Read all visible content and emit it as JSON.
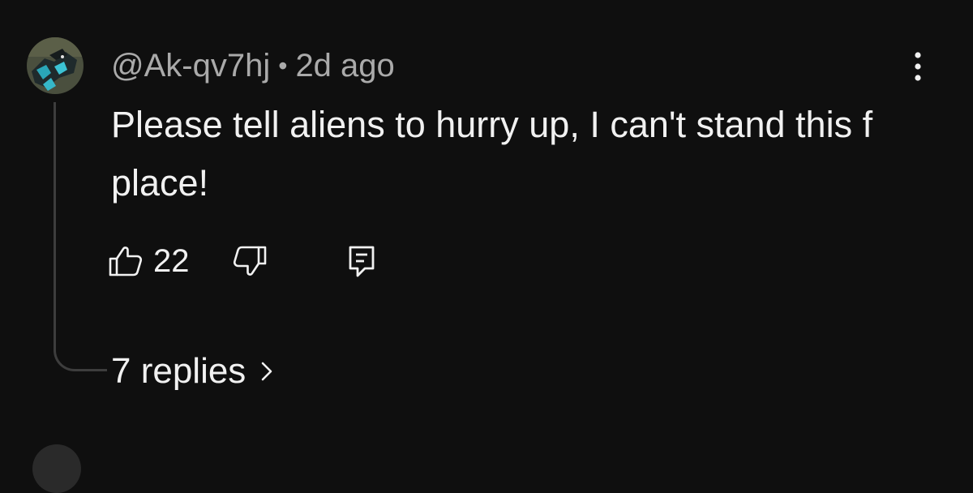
{
  "comment": {
    "author": "@Ak-qv7hj",
    "separator": "•",
    "time_ago": "2d ago",
    "text": "Please tell aliens to hurry up, I can't stand this f place!",
    "likes": "22",
    "icons": {
      "like": "thumbs-up-icon",
      "dislike": "thumbs-down-icon",
      "reply": "comment-reply-icon",
      "more": "more-vertical-icon",
      "chevron": "chevron-right-icon"
    },
    "replies_label": "7 replies"
  },
  "theme": {
    "background": "#0f0f0f",
    "text_primary": "#f1f1f1",
    "text_secondary": "#aaaaaa",
    "thread_line": "#3d3d3d"
  }
}
